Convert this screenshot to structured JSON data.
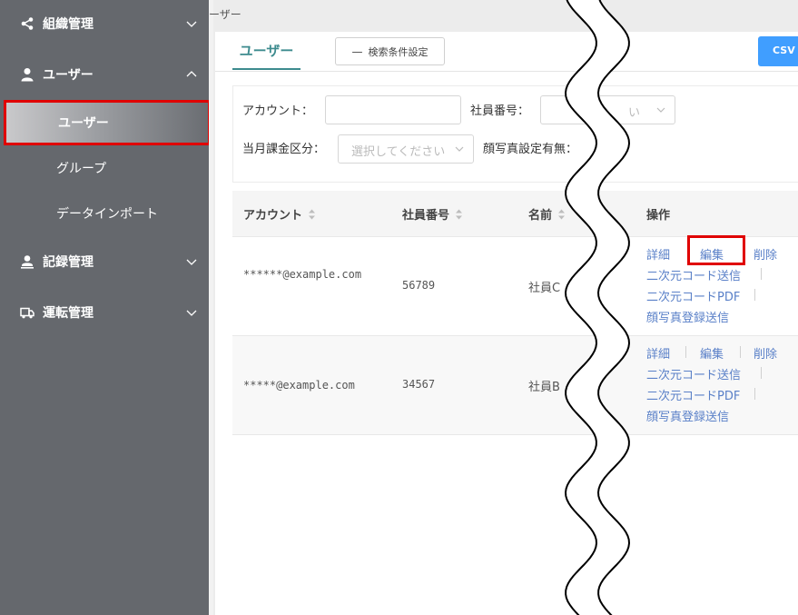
{
  "sidebar": {
    "items": [
      {
        "label": "組織管理",
        "icon": "share-icon",
        "expanded": false
      },
      {
        "label": "ユーザー",
        "icon": "person-icon",
        "expanded": true
      },
      {
        "label": "記録管理",
        "icon": "person-badge-icon",
        "expanded": false
      },
      {
        "label": "運転管理",
        "icon": "truck-icon",
        "expanded": false
      }
    ],
    "sub_items": [
      {
        "label": "ユーザー",
        "active": true
      },
      {
        "label": "グループ",
        "active": false
      },
      {
        "label": "データインポート",
        "active": false
      }
    ]
  },
  "breadcrumb": "ーザー",
  "header": {
    "tab_label": "ユーザー",
    "search_conditions_label": "検索条件設定",
    "csv_label": "CSV"
  },
  "filters": {
    "account_label": "アカウント：",
    "employee_no_label": "社員番号：",
    "employee_no_placeholder": "い",
    "billing_label": "当月課金区分：",
    "billing_placeholder": "選択してください",
    "face_photo_label": "顔写真設定有無："
  },
  "table": {
    "columns": [
      "アカウント",
      "社員番号",
      "名前",
      "操作"
    ],
    "rows": [
      {
        "account": "******@example.com",
        "employee_no": "56789",
        "name": "社員C",
        "actions": [
          "詳細",
          "編集",
          "削除",
          "二次元コード送信",
          "二次元コードPDF",
          "顔写真登録送信"
        ]
      },
      {
        "account": "*****@example.com",
        "employee_no": "34567",
        "name": "社員B",
        "actions": [
          "詳細",
          "編集",
          "削除",
          "二次元コード送信",
          "二次元コードPDF",
          "顔写真登録送信"
        ]
      }
    ]
  },
  "colors": {
    "sidebar_bg": "#65686d",
    "accent_teal": "#3d8b8e",
    "link_blue": "#5a80c8",
    "primary_button": "#409eff",
    "highlight_red": "#e00000"
  }
}
